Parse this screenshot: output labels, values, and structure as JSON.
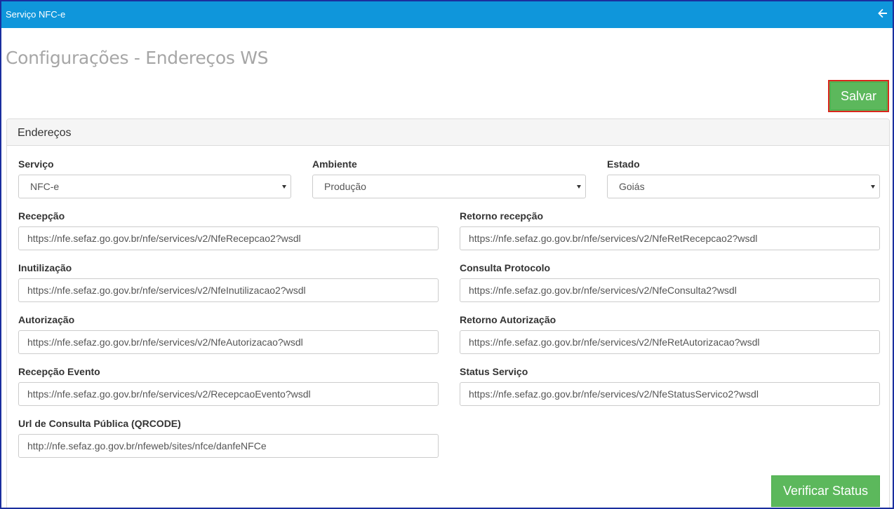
{
  "app": {
    "title": "Serviço NFC-e"
  },
  "page": {
    "title": "Configurações - Endereços WS",
    "save_label": "Salvar",
    "verify_label": "Verificar Status"
  },
  "panel": {
    "heading": "Endereços"
  },
  "filters": {
    "servico": {
      "label": "Serviço",
      "value": "NFC-e"
    },
    "ambiente": {
      "label": "Ambiente",
      "value": "Produção"
    },
    "estado": {
      "label": "Estado",
      "value": "Goiás"
    }
  },
  "fields": {
    "recepcao": {
      "label": "Recepção",
      "value": "https://nfe.sefaz.go.gov.br/nfe/services/v2/NfeRecepcao2?wsdl"
    },
    "retorno_recepcao": {
      "label": "Retorno recepção",
      "value": "https://nfe.sefaz.go.gov.br/nfe/services/v2/NfeRetRecepcao2?wsdl"
    },
    "inutilizacao": {
      "label": "Inutilização",
      "value": "https://nfe.sefaz.go.gov.br/nfe/services/v2/NfeInutilizacao2?wsdl"
    },
    "consulta_protocolo": {
      "label": "Consulta Protocolo",
      "value": "https://nfe.sefaz.go.gov.br/nfe/services/v2/NfeConsulta2?wsdl"
    },
    "autorizacao": {
      "label": "Autorização",
      "value": "https://nfe.sefaz.go.gov.br/nfe/services/v2/NfeAutorizacao?wsdl"
    },
    "retorno_autorizacao": {
      "label": "Retorno Autorização",
      "value": "https://nfe.sefaz.go.gov.br/nfe/services/v2/NfeRetAutorizacao?wsdl"
    },
    "recepcao_evento": {
      "label": "Recepção Evento",
      "value": "https://nfe.sefaz.go.gov.br/nfe/services/v2/RecepcaoEvento?wsdl"
    },
    "status_servico": {
      "label": "Status Serviço",
      "value": "https://nfe.sefaz.go.gov.br/nfe/services/v2/NfeStatusServico2?wsdl"
    },
    "url_consulta_publica": {
      "label": "Url de Consulta Pública (QRCODE)",
      "value": "http://nfe.sefaz.go.gov.br/nfeweb/sites/nfce/danfeNFCe"
    }
  },
  "icons": {
    "back": "arrow-left-icon",
    "dropdown": "caret-down-icon"
  },
  "colors": {
    "topbar": "#0f96db",
    "frame_border": "#1a2e9e",
    "success": "#5cb85c",
    "highlight": "#d9261c"
  }
}
